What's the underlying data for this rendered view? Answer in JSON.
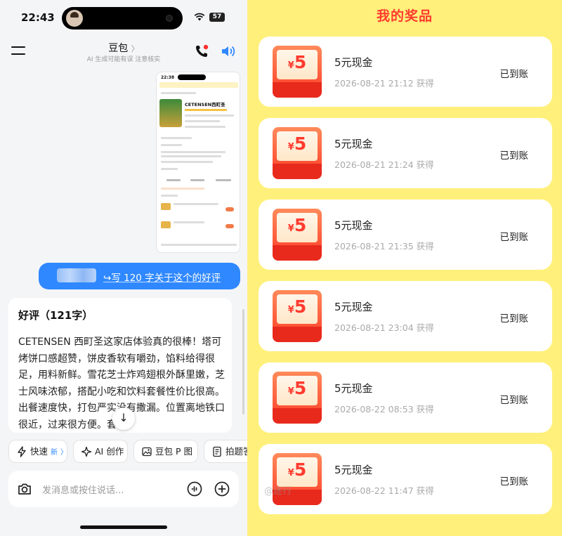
{
  "left": {
    "status": {
      "time": "22:43",
      "battery": "57"
    },
    "header": {
      "title": "豆包",
      "subtitle": "AI 生成可能有误 注意核实"
    },
    "image_card": {
      "time": "22:38",
      "shop_name": "CETENSEN西町圣"
    },
    "user_message": "写 120 字关于这个的好评",
    "ai_reply": {
      "title": "好评（121字）",
      "body": "CETENSEN 西町圣这家店体验真的很棒！塔可烤饼口感超赞，饼皮香软有嚼劲，馅料给得很足，用料新鲜。雪花芝士炸鸡翅根外酥里嫩，芝士风味浓郁，搭配小吃和饮料套餐性价比很高。出餐速度快，打包严实没有撒漏。位置离地铁口很近，过来很方便。套餐"
    },
    "chips": [
      {
        "label": "快速",
        "badge": "新"
      },
      {
        "label": "AI 创作"
      },
      {
        "label": "豆包 P 图"
      },
      {
        "label": "拍题答"
      }
    ],
    "input": {
      "placeholder": "发消息或按住说话..."
    }
  },
  "right": {
    "title": "我的奖品",
    "prizes": [
      {
        "amount": "5",
        "currency": "¥",
        "name": "5元现金",
        "time": "2026-08-21 21:12 获得",
        "status": "已到账"
      },
      {
        "amount": "5",
        "currency": "¥",
        "name": "5元现金",
        "time": "2026-08-21 21:24 获得",
        "status": "已到账"
      },
      {
        "amount": "5",
        "currency": "¥",
        "name": "5元现金",
        "time": "2026-08-21 21:35 获得",
        "status": "已到账"
      },
      {
        "amount": "5",
        "currency": "¥",
        "name": "5元现金",
        "time": "2026-08-21 23:04 获得",
        "status": "已到账"
      },
      {
        "amount": "5",
        "currency": "¥",
        "name": "5元现金",
        "time": "2026-08-22 08:53 获得",
        "status": "已到账"
      },
      {
        "amount": "5",
        "currency": "¥",
        "name": "5元现金",
        "time": "2026-08-22 11:47 获得",
        "status": "已到账"
      }
    ],
    "watermark": "@迷行"
  },
  "colors": {
    "accent_blue": "#2f88ff",
    "prize_red": "#ff3b2f",
    "panel_yellow": "#fff07c"
  }
}
